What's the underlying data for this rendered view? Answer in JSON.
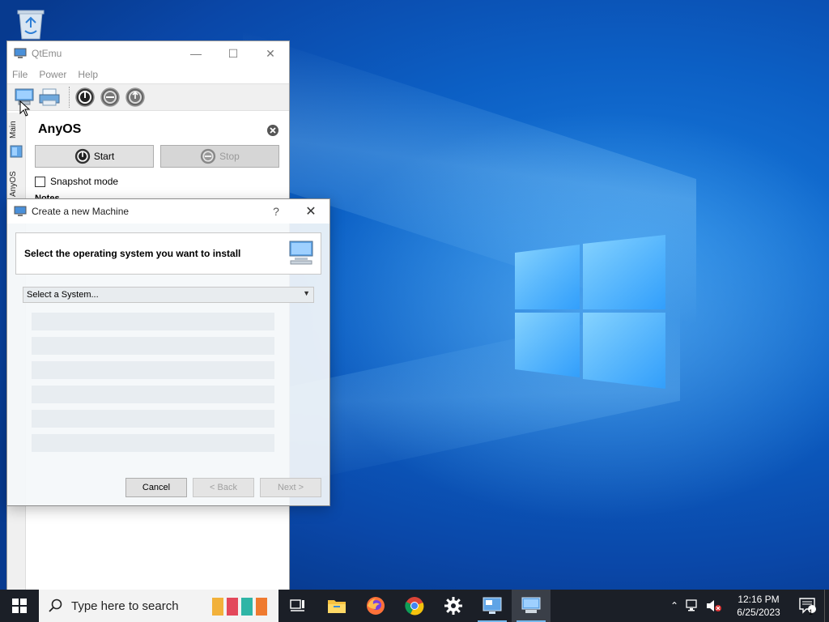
{
  "desktop": {
    "recycle_bin_icon": "recycle-bin-icon"
  },
  "qtemu": {
    "title": "QtEmu",
    "menu": [
      "File",
      "Power",
      "Help"
    ],
    "toolbar_icons": [
      "new-machine-icon",
      "printer-icon",
      "power-on-icon",
      "power-off-icon",
      "reset-icon"
    ],
    "side_tabs": [
      "Main",
      "AnyOS"
    ],
    "machine_name": "AnyOS",
    "start_label": "Start",
    "stop_label": "Stop",
    "snapshot_label": "Snapshot mode",
    "notes_label": "Notes"
  },
  "dialog": {
    "title": "Create a new Machine",
    "help_label": "?",
    "header_text": "Select the operating system you want to install",
    "select_value": "Select a System...",
    "cancel_label": "Cancel",
    "back_label": "< Back",
    "next_label": "Next >"
  },
  "taskbar": {
    "search_placeholder": "Type here to search",
    "time": "12:16 PM",
    "date": "6/25/2023",
    "notification_count": "1",
    "pinned": [
      "task-view-icon",
      "file-explorer-icon",
      "firefox-icon",
      "chrome-icon",
      "settings-icon",
      "remote-desktop-icon",
      "qtemu-icon"
    ]
  },
  "colors": {
    "accent": "#0078d7",
    "taskbar_bg": "#1b1f27",
    "desktop_blue": "#0c5fc4"
  }
}
